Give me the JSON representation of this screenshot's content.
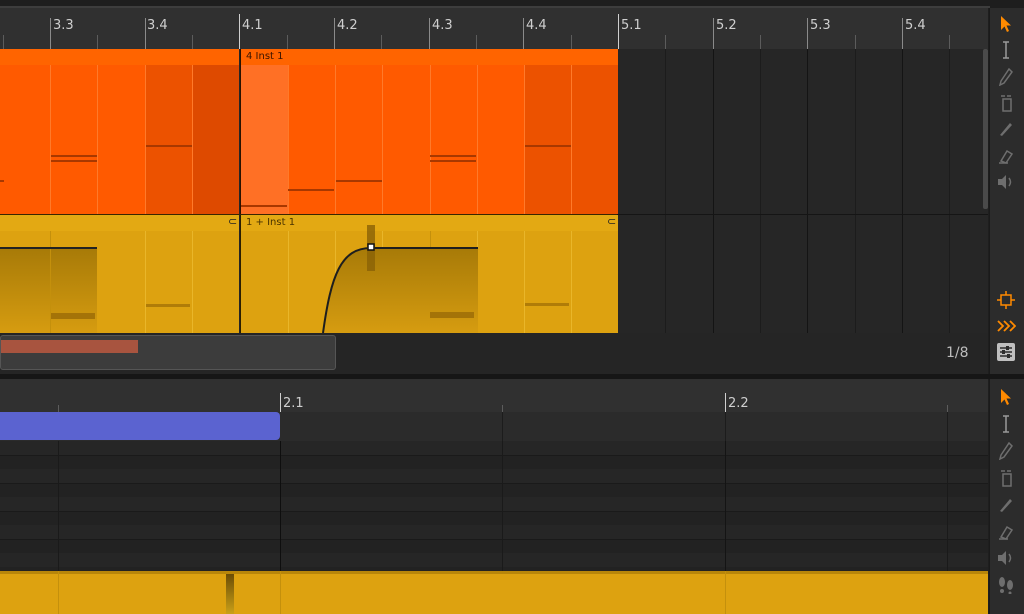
{
  "arranger": {
    "ruler_labels": [
      "3.3",
      "3.4",
      "4.1",
      "4.2",
      "4.3",
      "4.4",
      "5.1",
      "5.2",
      "5.3",
      "5.4"
    ],
    "clips": [
      {
        "name": "4 Inst 1",
        "color": "#ff5500",
        "track": "instrument"
      },
      {
        "name": "1 + Inst 1",
        "color": "#dda210",
        "track": "automation"
      }
    ],
    "page_indicator": "1/8"
  },
  "editor": {
    "ruler_labels": [
      "2.1",
      "2.2"
    ],
    "clip_color": "#5b63d0"
  },
  "tools": [
    "pointer-tool",
    "time-select-tool",
    "pencil-tool",
    "eraser-tool",
    "knife-tool",
    "paint-tool",
    "audition-tool"
  ],
  "colors": {
    "orange": "#ff5500",
    "gold": "#dda210",
    "accent": "#ff8a00",
    "blue": "#5b63d0"
  }
}
